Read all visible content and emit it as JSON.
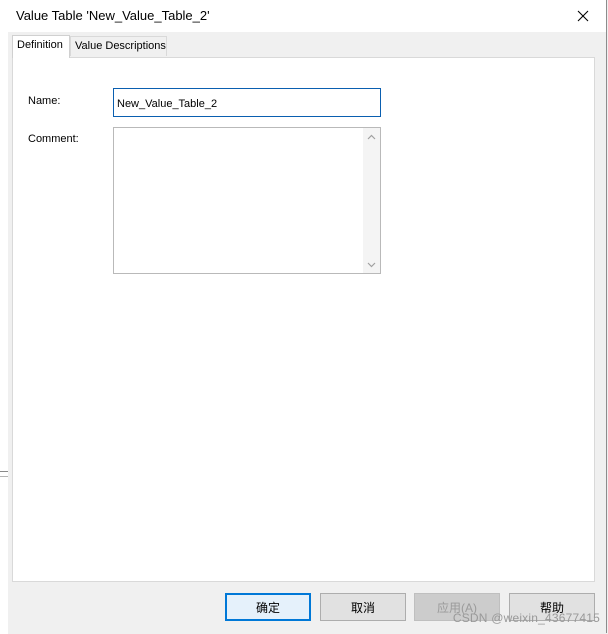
{
  "window": {
    "title": "Value Table 'New_Value_Table_2'"
  },
  "tabs": [
    {
      "label": "Definition",
      "active": true
    },
    {
      "label": "Value Descriptions",
      "active": false
    }
  ],
  "form": {
    "name_label": "Name:",
    "name_value": "New_Value_Table_2",
    "comment_label": "Comment:",
    "comment_value": ""
  },
  "buttons": {
    "ok": "确定",
    "cancel": "取消",
    "apply": "应用(A)",
    "help": "帮助"
  },
  "watermark": "CSDN @weixin_43677415",
  "colors": {
    "focus_border": "#0a5fb0",
    "default_button_border": "#0078d7"
  }
}
